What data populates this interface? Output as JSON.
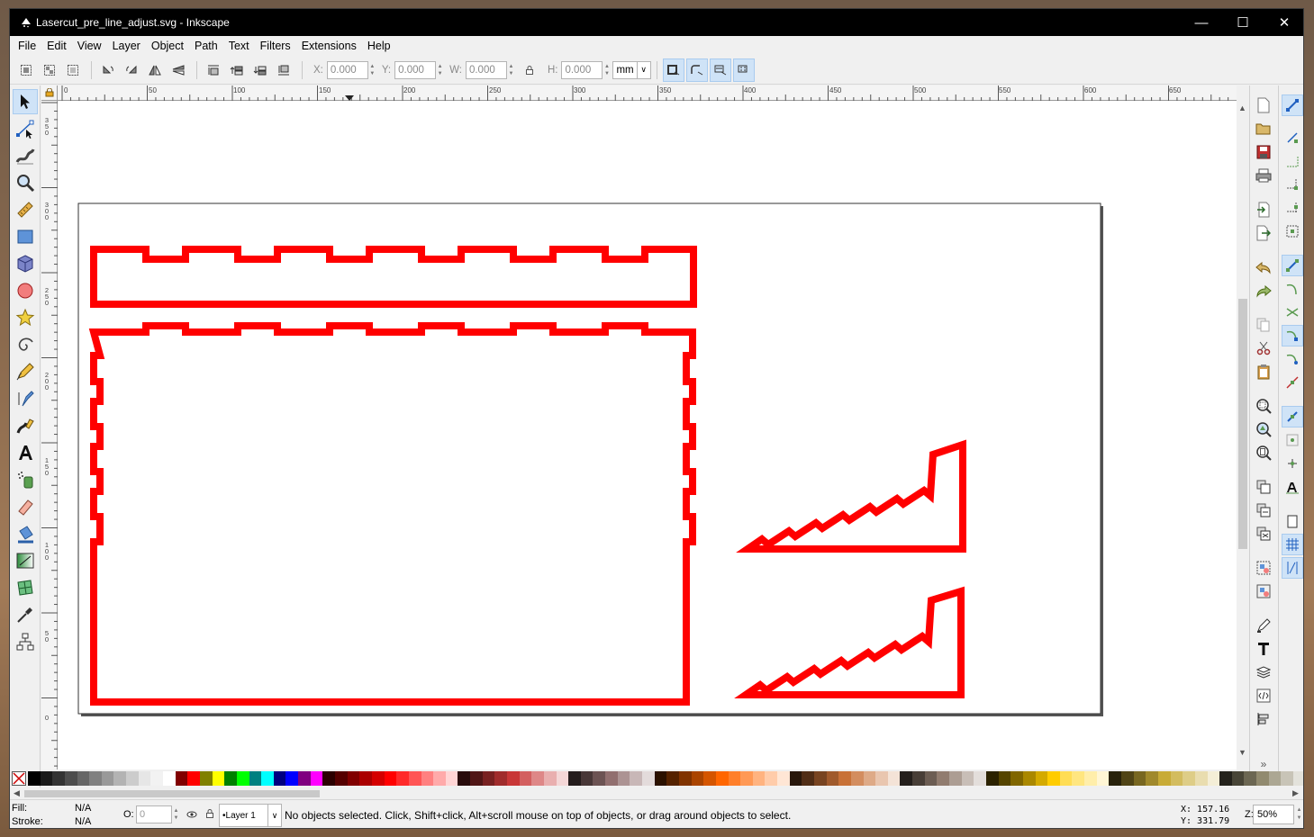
{
  "window": {
    "title": "Lasercut_pre_line_adjust.svg - Inkscape",
    "minimize_glyph": "—",
    "maximize_glyph": "☐",
    "close_glyph": "✕"
  },
  "menu": [
    "File",
    "Edit",
    "View",
    "Layer",
    "Object",
    "Path",
    "Text",
    "Filters",
    "Extensions",
    "Help"
  ],
  "toolbar": {
    "x_label": "X:",
    "x_value": "0.000",
    "y_label": "Y:",
    "y_value": "0.000",
    "w_label": "W:",
    "w_value": "0.000",
    "h_label": "H:",
    "h_value": "0.000",
    "unit": "mm"
  },
  "ruler": {
    "h_labels": [
      "0",
      "50",
      "100",
      "150",
      "200",
      "250",
      "300",
      "350",
      "400",
      "450",
      "500",
      "550",
      "600",
      "650"
    ],
    "v_labels": [
      "3\n5\n0",
      "3\n0\n0",
      "2\n5\n0",
      "2\n0\n0",
      "1\n5\n0",
      "1\n0\n0",
      "5\n0",
      "0"
    ]
  },
  "status": {
    "fill_label": "Fill:",
    "fill_value": "N/A",
    "stroke_label": "Stroke:",
    "stroke_value": "N/A",
    "opacity_label": "O:",
    "opacity_value": "0",
    "layer": "•Layer 1",
    "message": "No objects selected. Click, Shift+click, Alt+scroll mouse on top of objects, or drag around objects to select.",
    "cursor_x": "X:  157.16",
    "cursor_y": "Y:  331.79",
    "zoom_label": "Z:",
    "zoom_value": "50%"
  },
  "colors": {
    "path_stroke": "#ff0000",
    "selection_accent": "#cfe3f7"
  },
  "palette": [
    "#000000",
    "#1a1a1a",
    "#333333",
    "#4d4d4d",
    "#666666",
    "#808080",
    "#999999",
    "#b3b3b3",
    "#cccccc",
    "#e6e6e6",
    "#f2f2f2",
    "#ffffff",
    "#800000",
    "#ff0000",
    "#808000",
    "#ffff00",
    "#008000",
    "#00ff00",
    "#008080",
    "#00ffff",
    "#000080",
    "#0000ff",
    "#800080",
    "#ff00ff",
    "#2b0000",
    "#550000",
    "#800000",
    "#aa0000",
    "#d40000",
    "#ff0000",
    "#ff2a2a",
    "#ff5555",
    "#ff8080",
    "#ffaaaa",
    "#ffd5d5",
    "#280b0b",
    "#501616",
    "#782121",
    "#a02c2c",
    "#c83737",
    "#d35f5f",
    "#de8787",
    "#e9afaf",
    "#f4d7d7",
    "#241c1c",
    "#483737",
    "#6c5353",
    "#916f6f",
    "#ac9393",
    "#c8b7b7",
    "#e3dbdb",
    "#2b1100",
    "#552200",
    "#803300",
    "#aa4400",
    "#d45500",
    "#ff6600",
    "#ff7f2a",
    "#ff9955",
    "#ffb380",
    "#ffccaa",
    "#ffe6d5",
    "#28170b",
    "#502d16",
    "#784421",
    "#a05a2c",
    "#c87137",
    "#d38d5f",
    "#deaa87",
    "#e9c6af",
    "#f4e3d7",
    "#241f1c",
    "#483e37",
    "#6c5d53",
    "#917c6f",
    "#ac9d93",
    "#c8beb7",
    "#e3dedb",
    "#2b2200",
    "#554400",
    "#806600",
    "#aa8800",
    "#d4aa00",
    "#ffcc00",
    "#ffdd55",
    "#ffe680",
    "#ffeeaa",
    "#fff6d5",
    "#28220b",
    "#504416",
    "#786721",
    "#a0892c",
    "#c8ab37",
    "#d3bc5f",
    "#decd87",
    "#e9ddaf",
    "#f4eed7",
    "#24221c",
    "#484537",
    "#6c6753",
    "#918a6f",
    "#aca793",
    "#c8c4b7",
    "#e3e2db"
  ]
}
